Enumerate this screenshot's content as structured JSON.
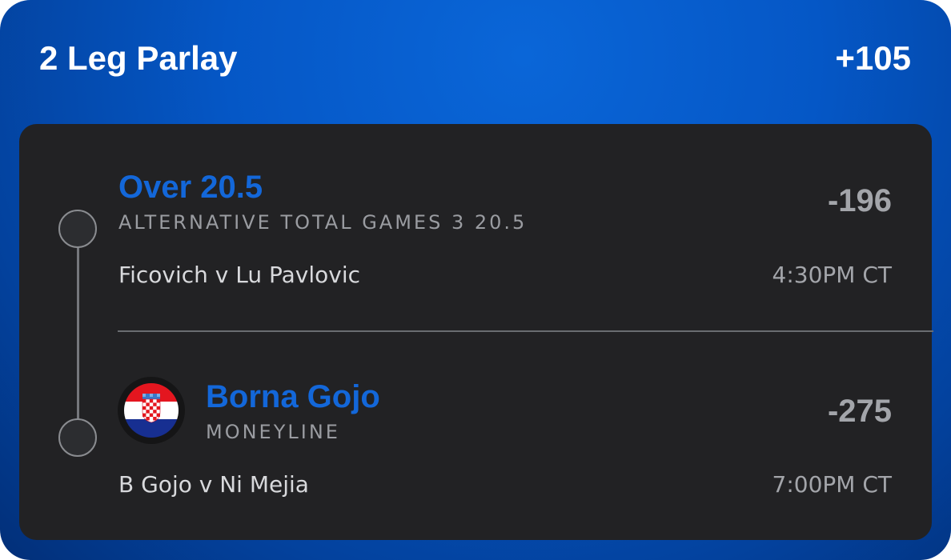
{
  "header": {
    "title": "2 Leg Parlay",
    "odds": "+105"
  },
  "legs": [
    {
      "selection": "Over 20.5",
      "market": "ALTERNATIVE TOTAL GAMES 3 20.5",
      "odds": "-196",
      "matchup": "Ficovich v Lu Pavlovic",
      "time": "4:30PM CT"
    },
    {
      "selection": "Borna Gojo",
      "market": "MONEYLINE",
      "odds": "-275",
      "matchup": "B Gojo v Ni Mejia",
      "time": "7:00PM CT",
      "flag_icon": "croatia-flag-icon"
    }
  ],
  "colors": {
    "accent": "#1367d9",
    "panel": "#222224",
    "background_blue": "#0557c6"
  }
}
